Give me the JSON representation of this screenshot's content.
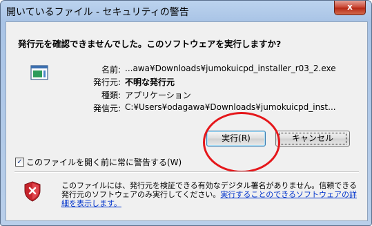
{
  "window": {
    "title": "開いているファイル - セキュリティの警告",
    "close_label": "x"
  },
  "dialog": {
    "question": "発行元を確認できませんでした。このソフトウェアを実行しますか?",
    "fields": {
      "name_label": "名前:",
      "name_value": "...awa¥Downloads¥jumokuicpd_installer_r03_2.exe",
      "publisher_label": "発行元:",
      "publisher_value": "不明な発行元",
      "type_label": "種類:",
      "type_value": "アプリケーション",
      "from_label": "発信元:",
      "from_value": "C:¥Users¥odagawa¥Downloads¥jumokuicpd_inst..."
    },
    "buttons": {
      "run": "実行(R)",
      "cancel": "キャンセル"
    },
    "checkbox": {
      "label": "このファイルを開く前に常に警告する(W)",
      "checked": true
    },
    "warning": {
      "text": "このファイルには、発行元を検証できる有効なデジタル署名がありません。信頼できる発行元のソフトウェアのみ実行してください。",
      "link": "実行することのできるソフトウェアの詳細を表示します。"
    }
  },
  "annotation": {
    "highlight_color": "#e5171b"
  },
  "icons": {
    "app": "application-icon",
    "shield": "warning-shield-icon"
  }
}
